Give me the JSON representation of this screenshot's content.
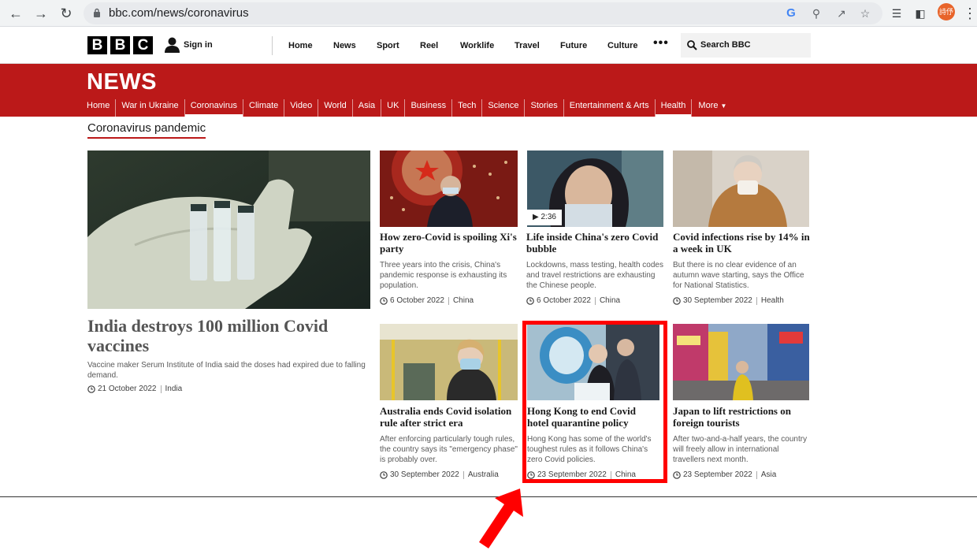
{
  "browser": {
    "url": "bbc.com/news/coronavirus",
    "profile_label": "詩伃",
    "icons": [
      "back-icon",
      "forward-icon",
      "reload-icon",
      "lock-icon",
      "google-icon",
      "zoom-icon",
      "share-icon",
      "bookmark-star-icon",
      "reading-list-icon",
      "side-panel-icon",
      "menu-icon"
    ]
  },
  "header": {
    "logo_letters": [
      "B",
      "B",
      "C"
    ],
    "signin": "Sign in",
    "nav": [
      "Home",
      "News",
      "Sport",
      "Reel",
      "Worklife",
      "Travel",
      "Future",
      "Culture"
    ],
    "more": "•••",
    "search_placeholder": "Search BBC"
  },
  "news": {
    "title": "NEWS",
    "nav": [
      "Home",
      "War in Ukraine",
      "Coronavirus",
      "Climate",
      "Video",
      "World",
      "Asia",
      "UK",
      "Business",
      "Tech",
      "Science",
      "Stories",
      "Entertainment & Arts",
      "Health"
    ],
    "more": "More",
    "active_items": [
      "Coronavirus",
      "Health"
    ]
  },
  "section_title": "Coronavirus pandemic",
  "lead": {
    "headline": "India destroys 100 million Covid vaccines",
    "summary": "Vaccine maker Serum Institute of India said the doses had expired due to falling demand.",
    "date": "21 October 2022",
    "tag": "India"
  },
  "cards": [
    {
      "headline": "How zero-Covid is spoiling Xi's party",
      "summary": "Three years into the crisis, China's pandemic response is exhausting its population.",
      "date": "6 October 2022",
      "tag": "China"
    },
    {
      "headline": "Life inside China's zero Covid bubble",
      "summary": "Lockdowns, mass testing, health codes and travel restrictions are exhausting the Chinese people.",
      "date": "6 October 2022",
      "tag": "China",
      "video_duration": "2:36"
    },
    {
      "headline": "Covid infections rise by 14% in a week in UK",
      "summary": "But there is no clear evidence of an autumn wave starting, says the Office for National Statistics.",
      "date": "30 September 2022",
      "tag": "Health"
    },
    {
      "headline": "Australia ends Covid isolation rule after strict era",
      "summary": "After enforcing particularly tough rules, the country says its \"emergency phase\" is probably over.",
      "date": "30 September 2022",
      "tag": "Australia"
    },
    {
      "headline": "Hong Kong to end Covid hotel quarantine policy",
      "summary": "Hong Kong has some of the world's toughest rules as it follows China's zero Covid policies.",
      "date": "23 September 2022",
      "tag": "China"
    },
    {
      "headline": "Japan to lift restrictions on foreign tourists",
      "summary": "After two-and-a-half years, the country will freely allow in international travellers next month.",
      "date": "23 September 2022",
      "tag": "Asia"
    }
  ],
  "colors": {
    "bbc_red": "#bb1919",
    "highlight": "#ff0000"
  }
}
